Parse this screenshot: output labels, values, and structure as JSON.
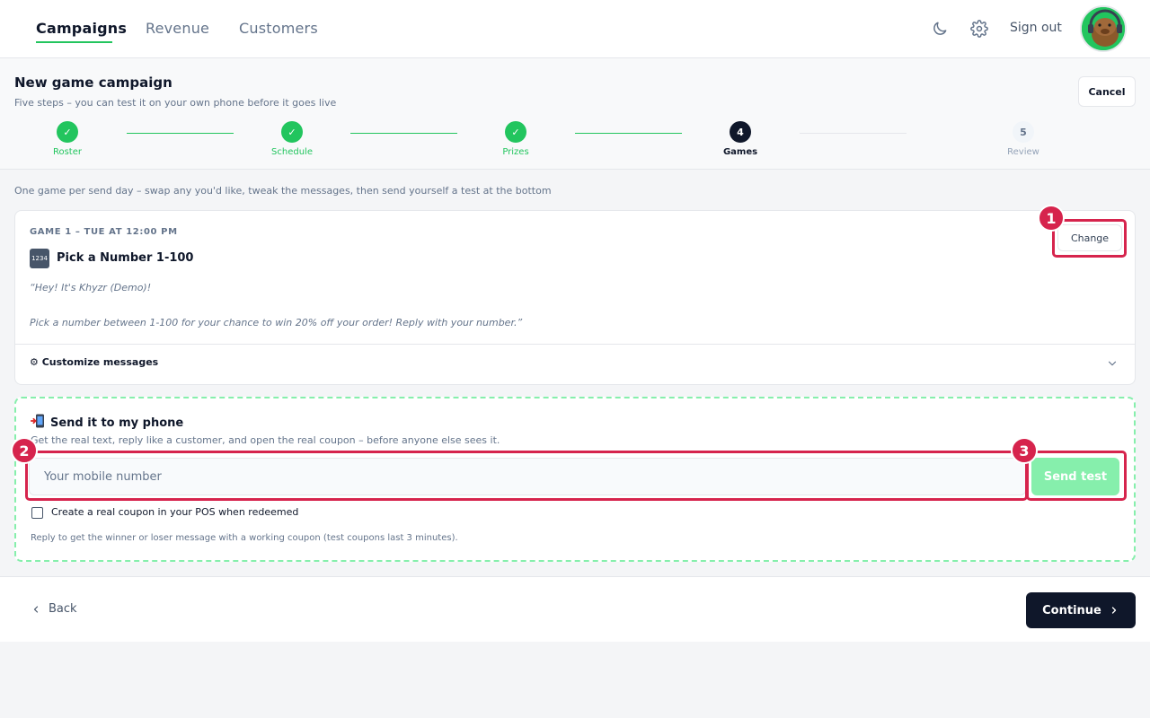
{
  "nav": {
    "tabs": [
      {
        "label": "Campaigns",
        "active": true
      },
      {
        "label": "Revenue",
        "active": false
      },
      {
        "label": "Customers",
        "active": false
      }
    ],
    "icons": [
      "moon-icon",
      "gear-icon"
    ],
    "signout_label": "Sign out",
    "accent_color": "#22c55e"
  },
  "header": {
    "title": "New game campaign",
    "subtitle": "Five steps – you can test it on your own phone before it goes live",
    "cancel_label": "Cancel"
  },
  "stepper": {
    "steps": [
      {
        "label": "Roster",
        "status": "done",
        "marker": "✓"
      },
      {
        "label": "Schedule",
        "status": "done",
        "marker": "✓"
      },
      {
        "label": "Prizes",
        "status": "done",
        "marker": "✓"
      },
      {
        "label": "Games",
        "status": "current",
        "marker": "4"
      },
      {
        "label": "Review",
        "status": "todo",
        "marker": "5"
      }
    ]
  },
  "content": {
    "intro": "One game per send day – swap any you'd like, tweak the messages, then send yourself a test at the bottom",
    "game": {
      "label": "GAME 1 – TUE AT 12:00 PM",
      "emoji": "1234",
      "name": "Pick a Number 1-100",
      "message": "“Hey! It's Khyzr (Demo)!\n\nPick a number between 1-100 for your chance to win 20% off your order! Reply with your number.”",
      "change_label": "Change",
      "customize_label": "⚙ Customize messages"
    },
    "test": {
      "title": "Send it to my phone",
      "subtitle": "Get the real text, reply like a customer, and open the real coupon – before anyone else sees it.",
      "input_placeholder": "Your mobile number",
      "input_value": "",
      "send_label": "Send test",
      "checkbox_label": "Create a real coupon in your POS when redeemed",
      "checkbox_checked": false,
      "note": "Reply to get the winner or loser message with a working coupon (test coupons last 3 minutes)."
    }
  },
  "footer": {
    "back_label": "Back",
    "continue_label": "Continue"
  },
  "annotations": [
    {
      "number": "1",
      "target": "change-button"
    },
    {
      "number": "2",
      "target": "mobile-number-input"
    },
    {
      "number": "3",
      "target": "send-test-button"
    }
  ],
  "colors": {
    "success": "#22c55e",
    "primary_dark": "#0f172a",
    "annotation": "#d6244d"
  }
}
